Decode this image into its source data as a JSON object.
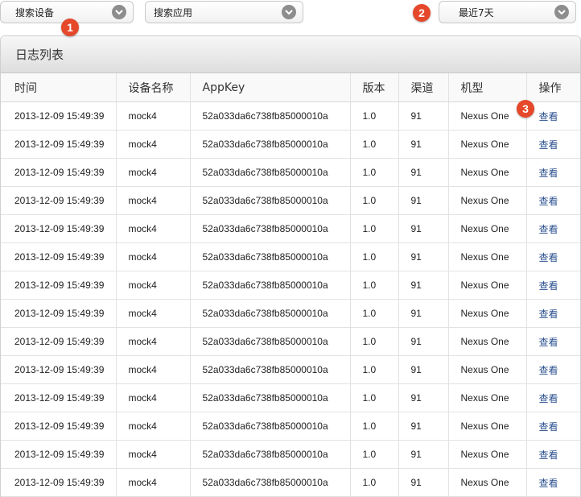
{
  "filters": {
    "device_search": "搜索设备",
    "app_search": "搜索应用",
    "time_range": "最近7天"
  },
  "badges": [
    "1",
    "2",
    "3"
  ],
  "panel": {
    "title": "日志列表"
  },
  "table": {
    "headers": [
      "时间",
      "设备名称",
      "AppKey",
      "版本",
      "渠道",
      "机型",
      "操作"
    ],
    "rows": [
      [
        "2013-12-09 15:49:39",
        "mock4",
        "52a033da6c738fb85000010a",
        "1.0",
        "91",
        "Nexus One",
        "查看"
      ],
      [
        "2013-12-09 15:49:39",
        "mock4",
        "52a033da6c738fb85000010a",
        "1.0",
        "91",
        "Nexus One",
        "查看"
      ],
      [
        "2013-12-09 15:49:39",
        "mock4",
        "52a033da6c738fb85000010a",
        "1.0",
        "91",
        "Nexus One",
        "查看"
      ],
      [
        "2013-12-09 15:49:39",
        "mock4",
        "52a033da6c738fb85000010a",
        "1.0",
        "91",
        "Nexus One",
        "查看"
      ],
      [
        "2013-12-09 15:49:39",
        "mock4",
        "52a033da6c738fb85000010a",
        "1.0",
        "91",
        "Nexus One",
        "查看"
      ],
      [
        "2013-12-09 15:49:39",
        "mock4",
        "52a033da6c738fb85000010a",
        "1.0",
        "91",
        "Nexus One",
        "查看"
      ],
      [
        "2013-12-09 15:49:39",
        "mock4",
        "52a033da6c738fb85000010a",
        "1.0",
        "91",
        "Nexus One",
        "查看"
      ],
      [
        "2013-12-09 15:49:39",
        "mock4",
        "52a033da6c738fb85000010a",
        "1.0",
        "91",
        "Nexus One",
        "查看"
      ],
      [
        "2013-12-09 15:49:39",
        "mock4",
        "52a033da6c738fb85000010a",
        "1.0",
        "91",
        "Nexus One",
        "查看"
      ],
      [
        "2013-12-09 15:49:39",
        "mock4",
        "52a033da6c738fb85000010a",
        "1.0",
        "91",
        "Nexus One",
        "查看"
      ],
      [
        "2013-12-09 15:49:39",
        "mock4",
        "52a033da6c738fb85000010a",
        "1.0",
        "91",
        "Nexus One",
        "查看"
      ],
      [
        "2013-12-09 15:49:39",
        "mock4",
        "52a033da6c738fb85000010a",
        "1.0",
        "91",
        "Nexus One",
        "查看"
      ],
      [
        "2013-12-09 15:49:39",
        "mock4",
        "52a033da6c738fb85000010a",
        "1.0",
        "91",
        "Nexus One",
        "查看"
      ],
      [
        "2013-12-09 15:49:39",
        "mock4",
        "52a033da6c738fb85000010a",
        "1.0",
        "91",
        "Nexus One",
        "查看"
      ]
    ]
  },
  "icons": {
    "dropdown": "chevron-down-icon"
  },
  "colors": {
    "badge": "#e5482a",
    "link": "#2a4f8f",
    "chevron": "#8d8d8d"
  }
}
